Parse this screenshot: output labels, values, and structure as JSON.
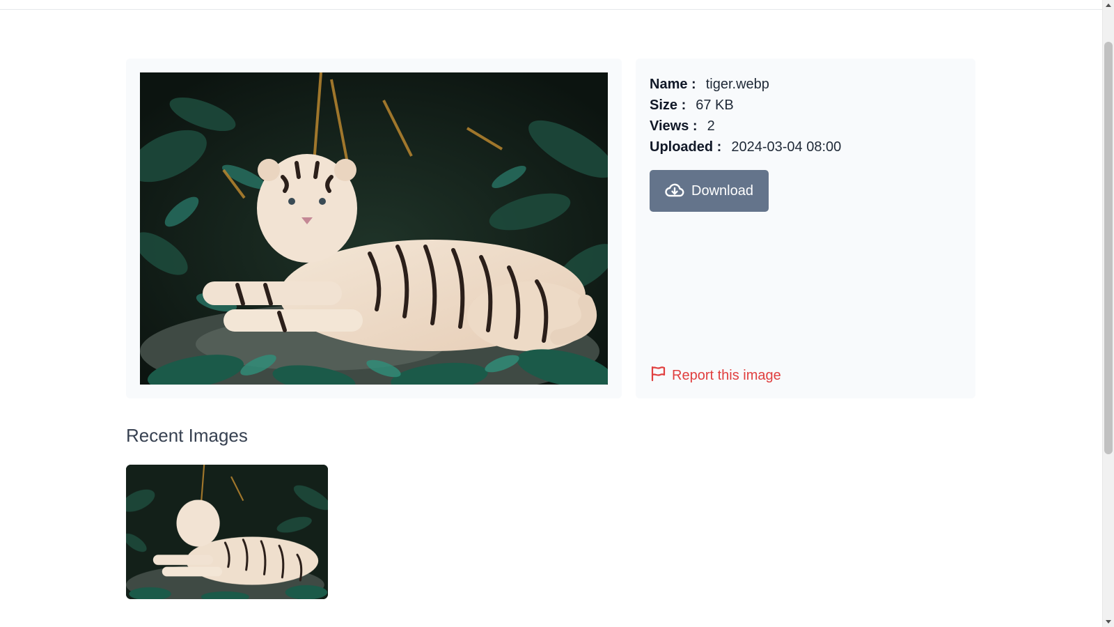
{
  "file_info": {
    "name_label": "Name :",
    "name_value": "tiger.webp",
    "size_label": "Size :",
    "size_value": "67 KB",
    "views_label": "Views :",
    "views_value": "2",
    "uploaded_label": "Uploaded :",
    "uploaded_value": "2024-03-04 08:00"
  },
  "actions": {
    "download_label": "Download",
    "download_icon": "cloud-download-icon",
    "report_label": "Report this image",
    "report_icon": "flag-icon"
  },
  "recent": {
    "title": "Recent Images",
    "items": [
      {
        "icon": "tiger-thumbnail"
      }
    ]
  },
  "colors": {
    "panel_bg": "#f8fafc",
    "download_bg": "#64748b",
    "report_color": "#e03e3e"
  }
}
